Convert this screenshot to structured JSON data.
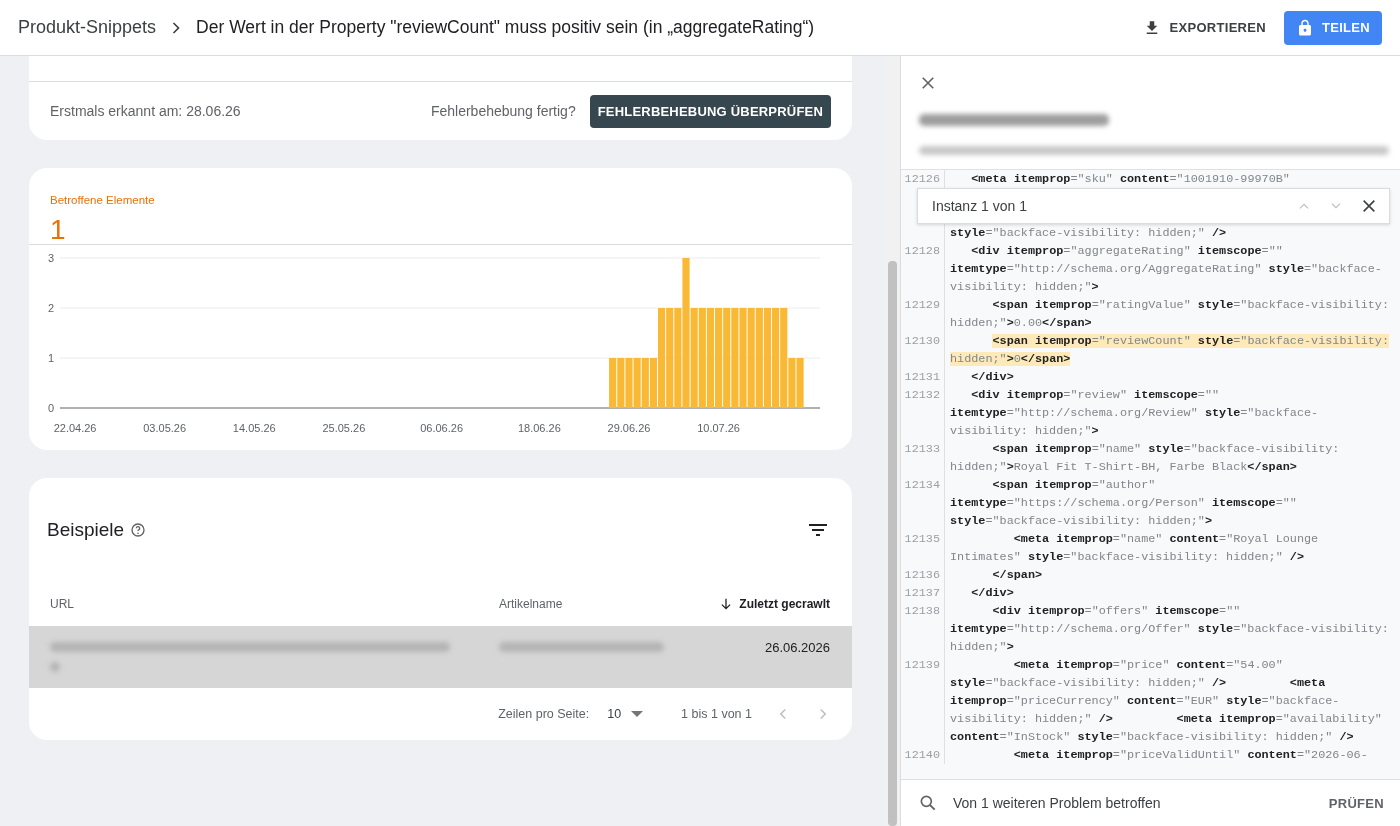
{
  "header": {
    "breadcrumb": "Produkt-Snippets",
    "title": "Der Wert in der Property \"reviewCount\" muss positiv sein (in „aggregateRating“)",
    "export_label": "EXPORTIEREN",
    "share_label": "TEILEN"
  },
  "status_card": {
    "first_detected": "Erstmals erkannt am: 28.06.26",
    "fix_question": "Fehlerbehebung fertig?",
    "validate_button": "FEHLERBEHEBUNG ÜBERPRÜFEN"
  },
  "affected_card": {
    "label": "Betroffene Elemente",
    "count": "1",
    "chart_data": {
      "type": "bar",
      "categories": [
        "22.04.26",
        null,
        null,
        null,
        null,
        null,
        null,
        null,
        null,
        null,
        null,
        "03.05.26",
        null,
        null,
        null,
        null,
        null,
        null,
        null,
        null,
        null,
        null,
        "14.05.26",
        null,
        null,
        null,
        null,
        null,
        null,
        null,
        null,
        null,
        null,
        "25.05.26",
        null,
        null,
        null,
        null,
        null,
        null,
        null,
        null,
        null,
        null,
        null,
        "06.06.26",
        null,
        null,
        null,
        null,
        null,
        null,
        null,
        null,
        null,
        null,
        null,
        "18.06.26",
        null,
        null,
        null,
        null,
        null,
        null,
        null,
        null,
        null,
        null,
        "29.06.26",
        null,
        null,
        null,
        null,
        null,
        null,
        null,
        null,
        null,
        null,
        "10.07.26",
        null,
        null,
        null,
        null,
        null,
        null,
        null,
        null,
        null,
        null
      ],
      "series": [
        {
          "color": "#f9b934",
          "values": [
            0,
            0,
            0,
            0,
            0,
            0,
            0,
            0,
            0,
            0,
            0,
            0,
            0,
            0,
            0,
            0,
            0,
            0,
            0,
            0,
            0,
            0,
            0,
            0,
            0,
            0,
            0,
            0,
            0,
            0,
            0,
            0,
            0,
            0,
            0,
            0,
            0,
            0,
            0,
            0,
            0,
            0,
            0,
            0,
            0,
            0,
            0,
            0,
            0,
            0,
            0,
            0,
            0,
            0,
            0,
            0,
            0,
            0,
            0,
            0,
            0,
            0,
            0,
            0,
            0,
            0,
            1,
            1,
            1,
            1,
            1,
            1,
            2,
            2,
            2,
            3,
            2,
            2,
            2,
            2,
            2,
            2,
            2,
            2,
            2,
            2,
            2,
            2,
            1,
            1
          ]
        }
      ],
      "ylim": [
        0,
        3
      ],
      "yticks": [
        0,
        1,
        2,
        3
      ]
    }
  },
  "examples_card": {
    "title": "Beispiele",
    "columns": [
      {
        "label": "URL",
        "sorted": false
      },
      {
        "label": "Artikelname",
        "sorted": false
      },
      {
        "label": "Zuletzt gecrawlt",
        "sorted": true
      }
    ],
    "rows": [
      {
        "selected": true,
        "last_crawled": "26.06.2026"
      }
    ],
    "pagination": {
      "rows_label": "Zeilen pro Seite:",
      "rows_value": "10",
      "range": "1 bis 1 von 1"
    }
  },
  "detail_panel": {
    "code": [
      {
        "kind": "line",
        "number": "12126",
        "highlighted": false,
        "rows": [
          "   **<meta** **itemprop**=\"sku\" **content**=\"1001910-99970B\""
        ]
      },
      {
        "kind": "find_bar",
        "text": "Instanz 1 von 1"
      },
      {
        "kind": "line",
        "highlighted": false,
        "rows": [
          "**style**=\"backface-visibility: hidden;\" **/>**"
        ]
      },
      {
        "kind": "line",
        "number": "12128",
        "highlighted": false,
        "rows": [
          "   **<div** **itemprop**=\"aggregateRating\" **itemscope**=\"\"",
          "**itemtype**=\"http://schema.org/AggregateRating\" **style**=\"backface-",
          "visibility: hidden;\"**>**"
        ]
      },
      {
        "kind": "line",
        "number": "12129",
        "highlighted": false,
        "rows": [
          "      **<span** **itemprop**=\"ratingValue\" **style**=\"backface-visibility:",
          "hidden;\"**>**0.00**</span>**"
        ]
      },
      {
        "kind": "line",
        "number": "12130",
        "highlighted": true,
        "rows": [
          "      **<span** **itemprop**=\"reviewCount\" **style**=\"backface-visibility:",
          "hidden;\"**>**0**</span>**"
        ]
      },
      {
        "kind": "line",
        "number": "12131",
        "highlighted": false,
        "rows": [
          "   **</div>**"
        ]
      },
      {
        "kind": "line",
        "number": "12132",
        "highlighted": false,
        "rows": [
          "   **<div** **itemprop**=\"review\" **itemscope**=\"\"",
          "**itemtype**=\"http://schema.org/Review\" **style**=\"backface-",
          "visibility: hidden;\"**>**"
        ]
      },
      {
        "kind": "line",
        "number": "12133",
        "highlighted": false,
        "rows": [
          "      **<span** **itemprop**=\"name\" **style**=\"backface-visibility:",
          "hidden;\"**>**Royal Fit T-Shirt-BH, Farbe Black**</span>**"
        ]
      },
      {
        "kind": "line",
        "number": "12134",
        "highlighted": false,
        "rows": [
          "      **<span** **itemprop**=\"author\"",
          "**itemtype**=\"https://schema.org/Person\" **itemscope**=\"\"",
          "**style**=\"backface-visibility: hidden;\"**>**"
        ]
      },
      {
        "kind": "line",
        "number": "12135",
        "highlighted": false,
        "rows": [
          "         **<meta** **itemprop**=\"name\" **content**=\"Royal Lounge",
          "Intimates\" **style**=\"backface-visibility: hidden;\" **/>**"
        ]
      },
      {
        "kind": "line",
        "number": "12136",
        "highlighted": false,
        "rows": [
          "      **</span>**"
        ]
      },
      {
        "kind": "line",
        "number": "12137",
        "highlighted": false,
        "rows": [
          "   **</div>**"
        ]
      },
      {
        "kind": "line",
        "number": "12138",
        "highlighted": false,
        "rows": [
          "      **<div** **itemprop**=\"offers\" **itemscope**=\"\"",
          "**itemtype**=\"http://schema.org/Offer\" **style**=\"backface-visibility:",
          "hidden;\"**>**"
        ]
      },
      {
        "kind": "line",
        "number": "12139",
        "highlighted": false,
        "rows": [
          "         **<meta** **itemprop**=\"price\" **content**=\"54.00\"",
          "**style**=\"backface-visibility: hidden;\" **/>**         **<meta**",
          "**itemprop**=\"priceCurrency\" **content**=\"EUR\" **style**=\"backface-",
          "visibility: hidden;\" **/>**         **<meta** **itemprop**=\"availability\"",
          "**content**=\"InStock\" **style**=\"backface-visibility: hidden;\" **/>**"
        ]
      },
      {
        "kind": "line",
        "number": "12140",
        "highlighted": false,
        "rows": [
          "         **<meta** **itemprop**=\"priceValidUntil\" **content**=\"2026-06-"
        ]
      }
    ],
    "footer": {
      "text": "Von 1 weiteren Problem betroffen",
      "action": "PRÜFEN"
    }
  }
}
